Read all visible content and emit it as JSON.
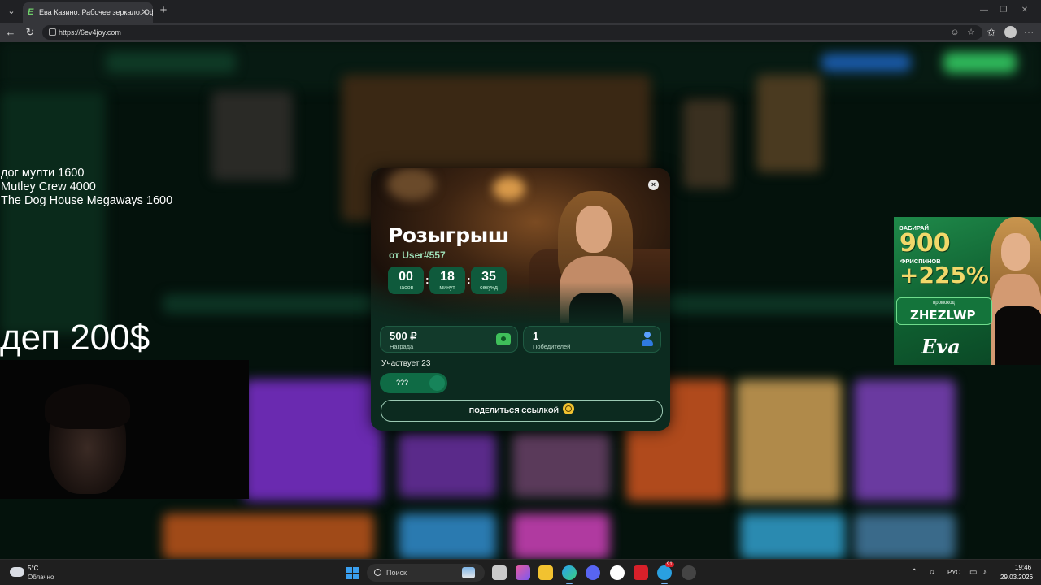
{
  "browser": {
    "tab_title": "Ева Казино. Рабочее зеркало. Оф",
    "tab_favicon": "E",
    "url": "https://6ev4joy.com",
    "icons": [
      "tab-search-icon",
      "favicon-icon",
      "close-icon",
      "plus-icon",
      "back-icon",
      "reload-icon",
      "site-info-icon",
      "reader-icon",
      "star-icon",
      "favorites-icon",
      "profile-avatar",
      "more-menu-icon",
      "minimize-icon",
      "restore-icon",
      "window-close-icon"
    ]
  },
  "overlay": {
    "lines": [
      "дог мулти 1600",
      "Mutley Crew 4000",
      "The Dog House Megaways 1600"
    ],
    "deposit": "деп 200$"
  },
  "giveaway": {
    "title": "Розыгрыш",
    "from": "от User#557",
    "timer": [
      {
        "value": "00",
        "unit": "часов"
      },
      {
        "value": "18",
        "unit": "минут"
      },
      {
        "value": "35",
        "unit": "секунд"
      }
    ],
    "separator": ":",
    "close": "×",
    "reward": {
      "value": "500 ₽",
      "label": "Награда"
    },
    "winners": {
      "value": "1",
      "label": "Победителей"
    },
    "participants": "Участвует 23",
    "toggle_label": "???",
    "share_label": "ПОДЕЛИТЬСЯ ССЫЛКОЙ"
  },
  "promo": {
    "line1": "ЗАБИРАЙ",
    "amount": "900",
    "line2": "ФРИСПИНОВ",
    "bonus": "+225%",
    "code_label": "промокод",
    "code": "ZHEZLWP",
    "logo": "Eva"
  },
  "taskbar": {
    "temperature": "5°C",
    "weather": "Облачно",
    "search_placeholder": "Поиск",
    "language": "РУС",
    "time": "19:46",
    "date": "29.03.2026",
    "app_badge": "91"
  },
  "colors": {
    "accent_green": "#0f5a3c",
    "modal_bg": "#0c2a1f",
    "promo_gold": "#f2d86a"
  }
}
